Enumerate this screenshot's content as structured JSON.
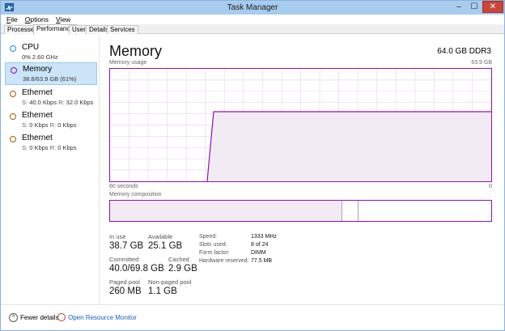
{
  "window": {
    "title": "Task Manager"
  },
  "caption": {
    "minimize": "–",
    "maximize": "☐",
    "close": "✕"
  },
  "menu": [
    {
      "label": "File",
      "underline": "F",
      "rest": "ile"
    },
    {
      "label": "Options",
      "underline": "O",
      "rest": "ptions"
    },
    {
      "label": "View",
      "underline": "V",
      "rest": "iew"
    }
  ],
  "tabs": [
    "Processes",
    "Performance",
    "Users",
    "Details",
    "Services"
  ],
  "resources": [
    {
      "name": "CPU",
      "value": "0%  2.60 GHz",
      "color": "#1f8fd6"
    },
    {
      "name": "Memory",
      "value": "38.8/63.9 GB (61%)",
      "color": "#8b12ae"
    },
    {
      "name": "Ethernet",
      "send_label": "S:",
      "send": "40.0 Kbps",
      "recv_label": "R:",
      "recv": "32.0 Kbps",
      "color": "#a75b0d"
    },
    {
      "name": "Ethernet",
      "send_label": "S:",
      "send": "0 Kbps",
      "recv_label": "R:",
      "recv": "0 Kbps",
      "color": "#a75b0d"
    },
    {
      "name": "Ethernet",
      "send_label": "S:",
      "send": "0 Kbps",
      "recv_label": "R:",
      "recv": "0 Kbps",
      "color": "#a75b0d"
    }
  ],
  "memory": {
    "title": "Memory",
    "total": "64.0 GB DDR3",
    "usage_label": "Memory usage",
    "usage_max": "63.9 GB",
    "time_label": "60 seconds",
    "time_end": "0",
    "composition_label": "Memory composition",
    "stats": {
      "in_use": {
        "label": "In use",
        "value": "38.7 GB"
      },
      "available": {
        "label": "Available",
        "value": "25.1 GB"
      },
      "committed": {
        "label": "Committed",
        "value": "40.0/69.8 GB"
      },
      "cached": {
        "label": "Cached",
        "value": "2.9 GB"
      },
      "paged_pool": {
        "label": "Paged pool",
        "value": "260 MB"
      },
      "nonpaged_pool": {
        "label": "Non-paged pool",
        "value": "1.1 GB"
      }
    },
    "specs": {
      "speed": {
        "label": "Speed:",
        "value": "1333 MHz"
      },
      "slots": {
        "label": "Slots used:",
        "value": "8 of 24"
      },
      "form": {
        "label": "Form factor:",
        "value": "DIMM"
      },
      "reserved": {
        "label": "Hardware reserved:",
        "value": "77.5 MB"
      }
    }
  },
  "footer": {
    "fewer_details": "Fewer details",
    "open_monitor": "Open Resource Monitor"
  },
  "colors": {
    "memory": "#8b12ae",
    "grid": "#ead8ef",
    "fill": "#f2ebf4"
  }
}
